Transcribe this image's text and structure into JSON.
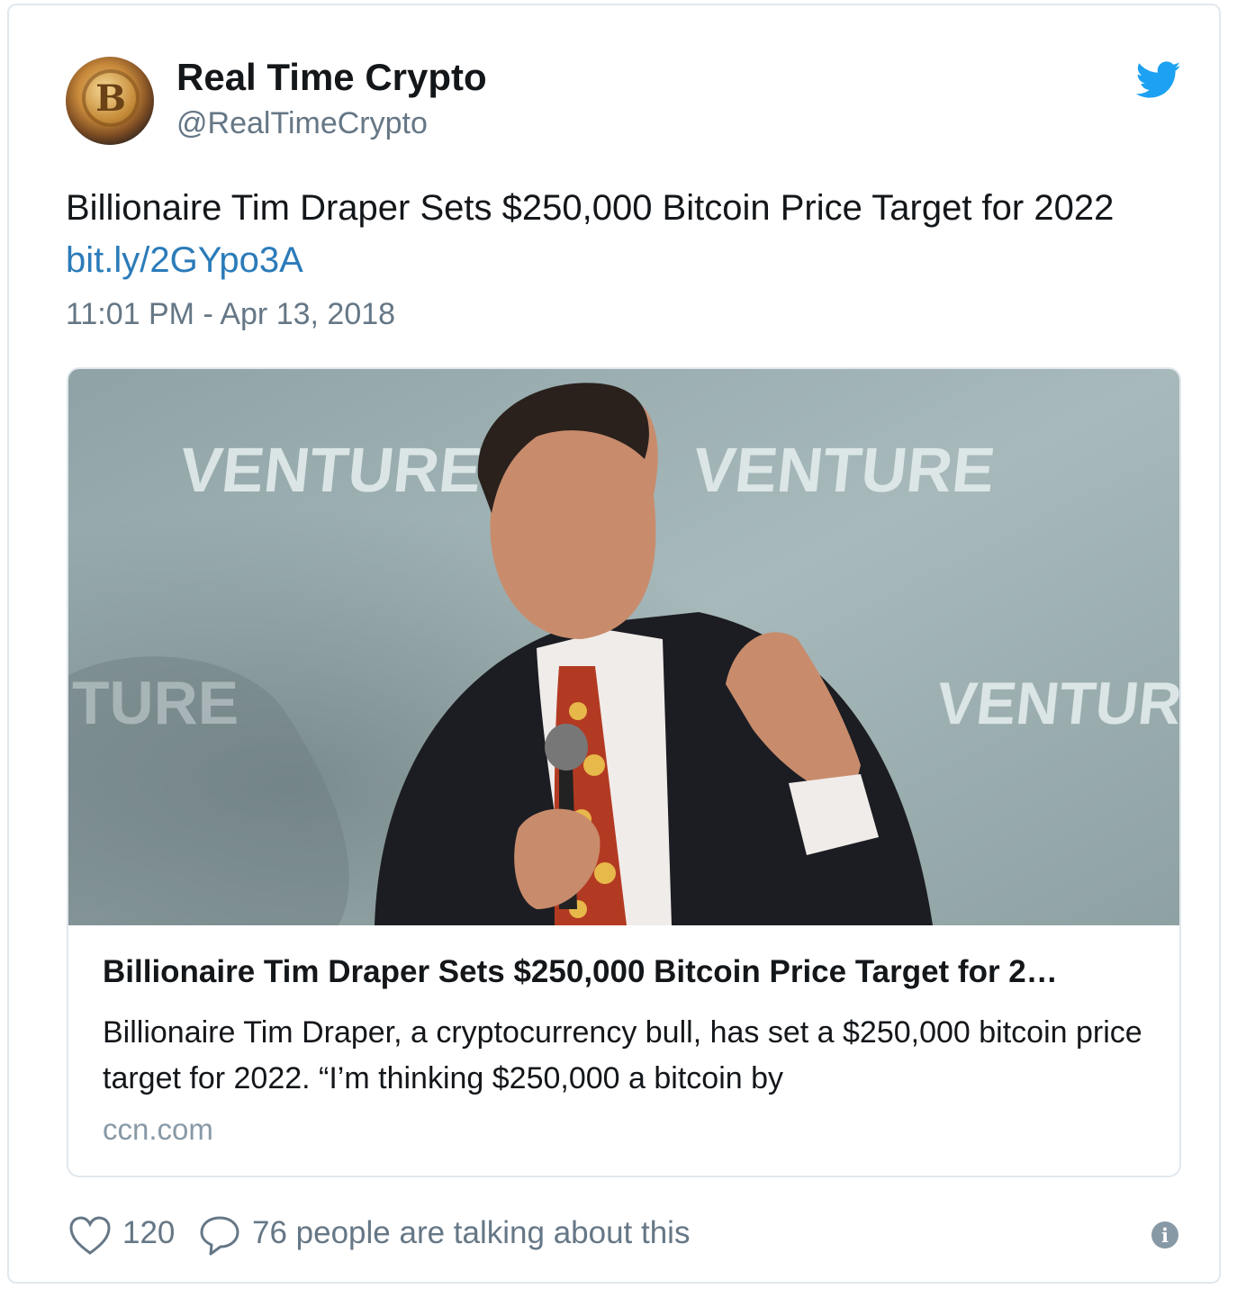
{
  "account": {
    "display_name": "Real Time Crypto",
    "handle": "@RealTimeCrypto",
    "avatar_icon": "bitcoin-coin-avatar",
    "avatar_glyph": "B"
  },
  "brand_icon": "twitter-bird-icon",
  "colors": {
    "brand": "#1da1f2",
    "link": "#2b7bb9",
    "muted": "#657786",
    "border": "#e1e8ed"
  },
  "tweet": {
    "text": "Billionaire Tim Draper Sets $250,000 Bitcoin Price Target for 2022",
    "link_text": "bit.ly/2GYpo3A",
    "timestamp": "11:01 PM - Apr 13, 2018"
  },
  "card": {
    "photo_backdrop_words": [
      "VENTURE",
      "VENTURE",
      "TURE",
      "VENTURE"
    ],
    "title": "Billionaire Tim Draper Sets $250,000 Bitcoin Price Target for 2…",
    "description": "Billionaire Tim Draper, a cryptocurrency bull, has set a $250,000 bitcoin price target for 2022. “I’m thinking $250,000 a bitcoin by",
    "domain": "ccn.com"
  },
  "footer": {
    "like_icon": "heart-icon",
    "likes": "120",
    "reply_icon": "speech-bubble-icon",
    "talking": "76 people are talking about this",
    "info_icon": "info-icon",
    "info_glyph": "i"
  }
}
